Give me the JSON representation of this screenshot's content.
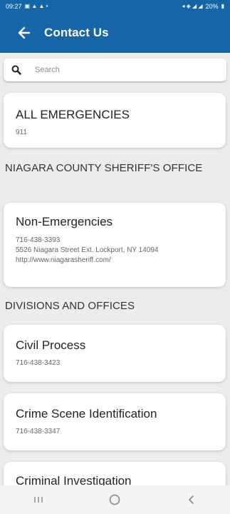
{
  "status": {
    "time": "09:27",
    "battery": "20%"
  },
  "header": {
    "title": "Contact Us"
  },
  "search": {
    "placeholder": "Search"
  },
  "emergency": {
    "title": "ALL EMERGENCIES",
    "phone": "911"
  },
  "sheriff_section": {
    "title": "NIAGARA COUNTY SHERIFF'S OFFICE"
  },
  "non_emergency": {
    "title": "Non-Emergencies",
    "phone": "716-438-3393",
    "address": "5526 Niagara Street Ext. Lockport, NY 14094",
    "website": "http://www.niagarasheriff.com/"
  },
  "divisions_section": {
    "title": "DIVISIONS AND OFFICES"
  },
  "divisions": [
    {
      "title": "Civil Process",
      "phone": "716-438-3423"
    },
    {
      "title": "Crime Scene Identification",
      "phone": "716-438-3347"
    },
    {
      "title": "Criminal Investigation"
    }
  ],
  "colors": {
    "brand": "#1565a8",
    "background": "#ececec"
  },
  "icons": {
    "back": "arrow-left-icon",
    "search": "search-icon"
  }
}
